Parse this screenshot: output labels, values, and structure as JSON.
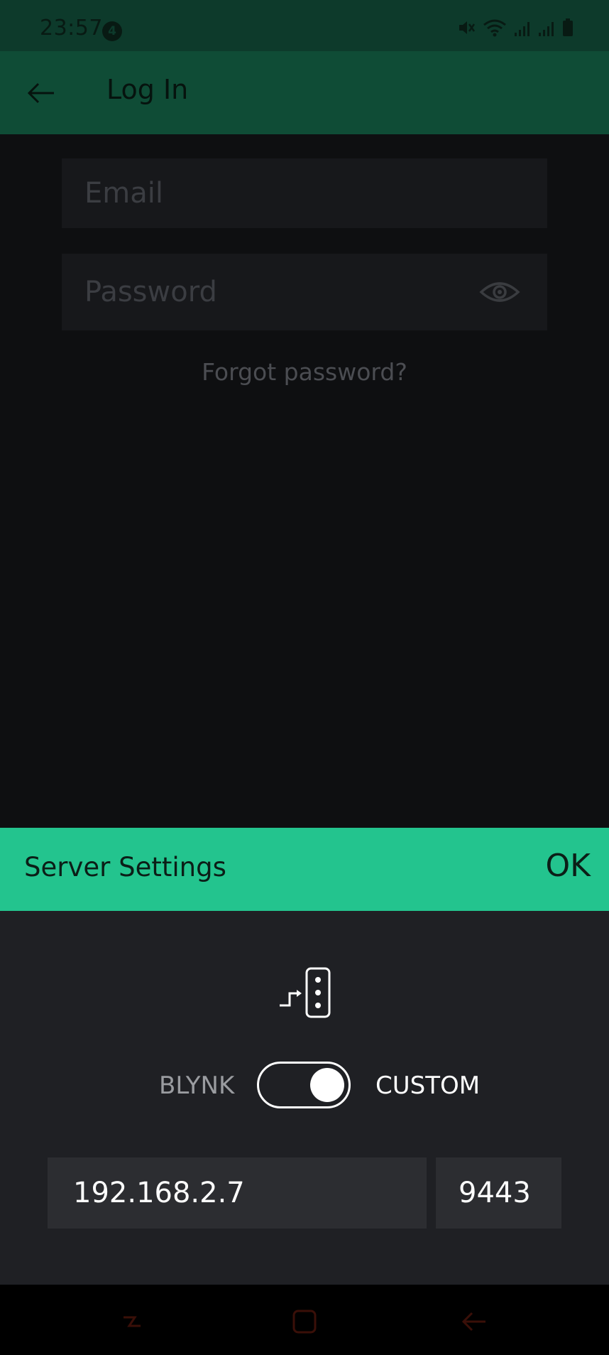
{
  "status_bar": {
    "time": "23:57",
    "notification_count": "4",
    "icons": [
      "mute-icon",
      "wifi-icon",
      "signal-icon",
      "signal-icon",
      "battery-icon"
    ]
  },
  "app_bar": {
    "title": "Log In",
    "back_icon": "arrow-left-icon"
  },
  "login": {
    "email_placeholder": "Email",
    "password_placeholder": "Password",
    "show_password_icon": "eye-icon",
    "forgot_password": "Forgot password?"
  },
  "server_settings": {
    "title": "Server Settings",
    "ok_label": "OK",
    "icon": "server-icon",
    "toggle_left_label": "BLYNK",
    "toggle_right_label": "CUSTOM",
    "custom_enabled": true,
    "host": "192.168.2.7",
    "port": "9443"
  },
  "nav_bar": {
    "buttons": [
      "recent-apps-icon",
      "home-icon",
      "back-icon"
    ]
  },
  "colors": {
    "status_bar": "#0d3a2b",
    "app_bar": "#0f4c36",
    "accent": "#23c48e",
    "background": "#0e0f11",
    "panel": "#1f2024",
    "input": "#2c2d31"
  }
}
